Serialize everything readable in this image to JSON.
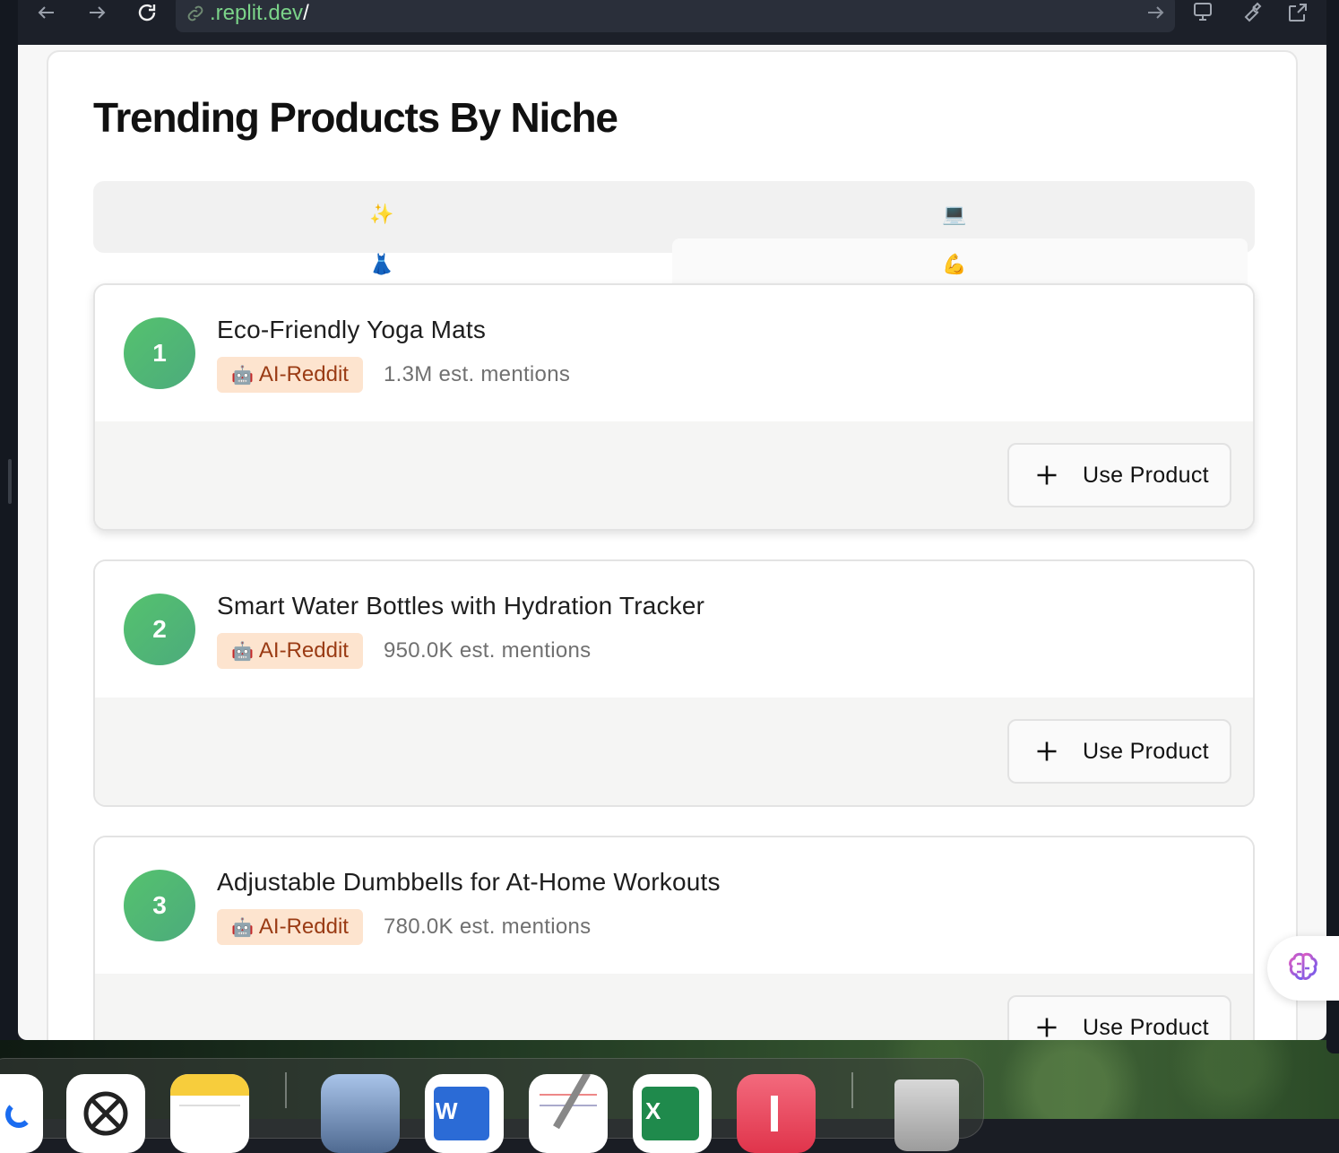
{
  "browser": {
    "url_domain": ".replit.dev",
    "url_path": "/"
  },
  "page": {
    "title": "Trending Products By Niche"
  },
  "tabs": [
    {
      "emoji": "✨",
      "name": "sparkles"
    },
    {
      "emoji": "💻",
      "name": "laptop"
    },
    {
      "emoji": "👗",
      "name": "dress"
    },
    {
      "emoji": "💪",
      "name": "flexed-biceps"
    }
  ],
  "products": [
    {
      "rank": "1",
      "name": "Eco-Friendly Yoga Mats",
      "source_icon": "🤖",
      "source": "AI-Reddit",
      "mentions": "1.3M est. mentions",
      "action": "Use Product"
    },
    {
      "rank": "2",
      "name": "Smart Water Bottles with Hydration Tracker",
      "source_icon": "🤖",
      "source": "AI-Reddit",
      "mentions": "950.0K est. mentions",
      "action": "Use Product"
    },
    {
      "rank": "3",
      "name": "Adjustable Dumbbells for At-Home Workouts",
      "source_icon": "🤖",
      "source": "AI-Reddit",
      "mentions": "780.0K est. mentions",
      "action": "Use Product"
    }
  ],
  "colors": {
    "rank_green": "#55c26e",
    "badge_bg": "#fde4cf",
    "badge_text": "#9a3b14",
    "url_domain": "#7bd389"
  },
  "dock_apps": [
    "app-icon",
    "chatgpt-icon",
    "notes-icon",
    "preview-icon",
    "word-icon",
    "textedit-icon",
    "excel-icon",
    "music-icon",
    "trash-icon"
  ]
}
